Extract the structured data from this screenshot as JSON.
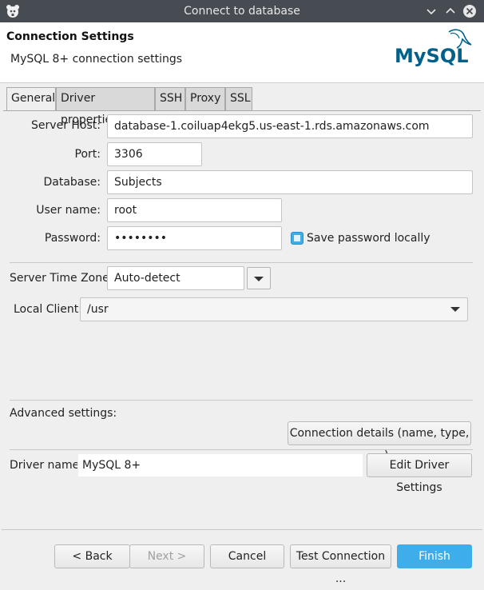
{
  "window": {
    "title": "Connect to database",
    "app_icon": "dbeaver-beaver-icon",
    "controls": [
      "chevron-down-icon",
      "chevron-up-icon",
      "close-icon"
    ]
  },
  "header": {
    "title": "Connection Settings",
    "subtitle": "MySQL 8+ connection settings",
    "logo_text": "MySQL"
  },
  "tabs": [
    {
      "label": "General",
      "active": true
    },
    {
      "label": "Driver properties",
      "active": false
    },
    {
      "label": "SSH",
      "active": false
    },
    {
      "label": "Proxy",
      "active": false
    },
    {
      "label": "SSL",
      "active": false
    }
  ],
  "form": {
    "server_host": {
      "label": "Server Host:",
      "value": "database-1.coiluap4ekg5.us-east-1.rds.amazonaws.com"
    },
    "port": {
      "label": "Port:",
      "value": "3306"
    },
    "database": {
      "label": "Database:",
      "value": "Subjects"
    },
    "user_name": {
      "label": "User name:",
      "value": "root"
    },
    "password": {
      "label": "Password:",
      "value": "••••••••"
    },
    "save_password": {
      "label": "Save password locally",
      "checked": true
    },
    "server_time_zone": {
      "label": "Server Time Zone:",
      "value": "Auto-detect"
    },
    "local_client": {
      "label": "Local Client:",
      "value": "/usr"
    }
  },
  "advanced": {
    "label": "Advanced settings:",
    "connection_details_button": "Connection details (name, type, ... )"
  },
  "driver": {
    "label": "Driver name:",
    "value": "MySQL 8+",
    "edit_button": "Edit Driver Settings"
  },
  "footer": {
    "back": "< Back",
    "next": "Next >",
    "cancel": "Cancel",
    "test": "Test Connection ...",
    "finish": "Finish"
  },
  "colors": {
    "accent": "#3daee9",
    "titlebar": "#474b52",
    "mysql_blue": "#00618a",
    "mysql_orange": "#e48e00"
  }
}
